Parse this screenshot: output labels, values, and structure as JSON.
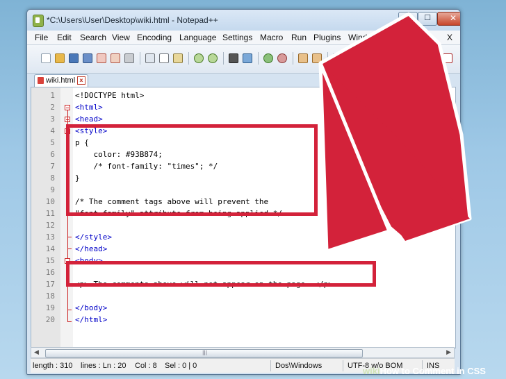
{
  "window": {
    "title": "*C:\\Users\\User\\Desktop\\wiki.html - Notepad++",
    "minimize_glyph": "─",
    "maximize_glyph": "☐",
    "close_glyph": "✕"
  },
  "menu": {
    "items": [
      "File",
      "Edit",
      "Search",
      "View",
      "Encoding",
      "Language",
      "Settings",
      "Macro",
      "Run",
      "Plugins",
      "Window",
      "?"
    ],
    "close_x": "X"
  },
  "tab": {
    "label": "wiki.html",
    "close": "x"
  },
  "editor": {
    "line_numbers": [
      "1",
      "2",
      "3",
      "4",
      "5",
      "6",
      "7",
      "8",
      "9",
      "10",
      "11",
      "12",
      "13",
      "14",
      "15",
      "16",
      "17",
      "18",
      "19",
      "20"
    ],
    "lines": [
      "<!DOCTYPE html>",
      "<html>",
      "<head>",
      "<style>",
      "p {",
      "    color: #93B874;",
      "    /* font-family: \"times\"; */",
      "}",
      "",
      "/* The comment tags above will prevent the",
      "\"font-family\" attribute from being applied */",
      "",
      "</style>",
      "</head>",
      "<body>",
      "",
      "<p> The comments above will not appear on the page. </p>",
      "",
      "</body>",
      "</html>"
    ]
  },
  "scrollbar": {
    "left": "◀",
    "right": "▶",
    "grip": "|||"
  },
  "status": {
    "length": "length : 310",
    "lines": "lines : Ln : 20",
    "col": "Col : 8",
    "sel": "Sel : 0 | 0",
    "eol": "Dos\\Windows",
    "encoding": "UTF-8 w/o BOM",
    "mode": "INS"
  },
  "watermark": {
    "wiki": "wiki",
    "rest": "How to Comment in CSS"
  },
  "colors": {
    "highlight": "#d3223a",
    "arrow": "#d3223a",
    "tag_blue": "#0000c8"
  }
}
